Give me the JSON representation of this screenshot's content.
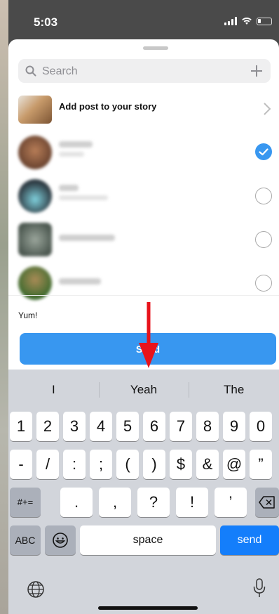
{
  "status": {
    "time": "5:03"
  },
  "search": {
    "placeholder": "Search"
  },
  "story": {
    "label": "Add post to your story"
  },
  "recipients": [
    {
      "selected": true
    },
    {
      "selected": false
    },
    {
      "selected": false
    },
    {
      "selected": false
    }
  ],
  "message": {
    "value": "Yum!"
  },
  "send_label": "Send",
  "suggestions": [
    "I",
    "Yeah",
    "The"
  ],
  "keyboard": {
    "row1": [
      "1",
      "2",
      "3",
      "4",
      "5",
      "6",
      "7",
      "8",
      "9",
      "0"
    ],
    "row2": [
      "-",
      "/",
      ":",
      ";",
      "(",
      ")",
      "$",
      "&",
      "@",
      "”"
    ],
    "row3_left": "#+=",
    "row3": [
      ".",
      ",",
      "?",
      "!",
      "’"
    ],
    "abc": "ABC",
    "space": "space",
    "send": "send"
  },
  "colors": {
    "accent": "#3897f0",
    "send_key": "#147efb",
    "annotation_arrow": "#e8131b"
  }
}
